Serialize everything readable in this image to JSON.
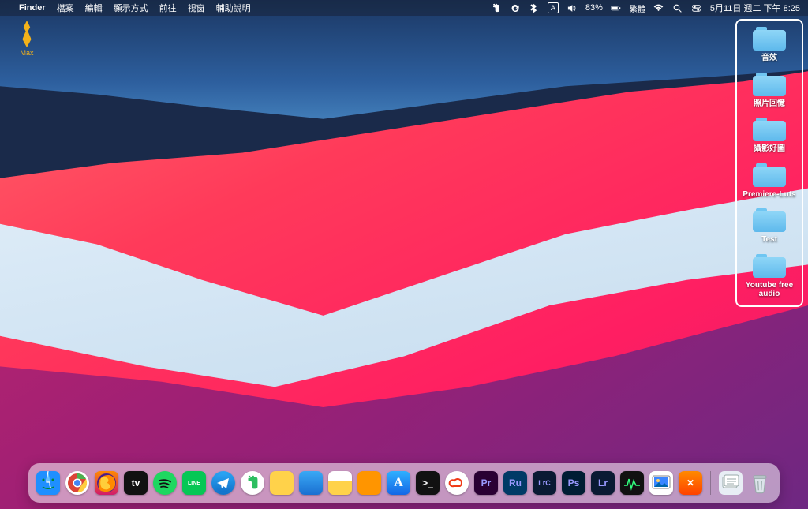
{
  "menubar": {
    "apple": "",
    "app_name": "Finder",
    "items": [
      "檔案",
      "編輯",
      "顯示方式",
      "前往",
      "視窗",
      "輔助說明"
    ],
    "status": {
      "battery": "83%",
      "input": "A",
      "lang": "繁體",
      "date": "5月11日 週二 下午 8:25"
    }
  },
  "desktop_icon": {
    "label": "Max"
  },
  "folders": [
    {
      "label": "音效"
    },
    {
      "label": "照片回憶"
    },
    {
      "label": "攝影好圖"
    },
    {
      "label": "Premiere-Luts"
    },
    {
      "label": "Test"
    },
    {
      "label": "Youtube free audio"
    }
  ],
  "dock": [
    {
      "name": "finder",
      "bg": "linear-gradient(#35a3f5,#1273e6)",
      "txt": ""
    },
    {
      "name": "chrome",
      "bg": "#fff",
      "txt": ""
    },
    {
      "name": "firefox",
      "bg": "linear-gradient(#ff8a00,#d11a6b)",
      "txt": ""
    },
    {
      "name": "apple-tv",
      "bg": "#111",
      "txt": "tv"
    },
    {
      "name": "spotify",
      "bg": "#1ed760",
      "txt": ""
    },
    {
      "name": "line",
      "bg": "#06c755",
      "txt": "LINE"
    },
    {
      "name": "telegram",
      "bg": "linear-gradient(#2aa4f4,#1271c9)",
      "txt": ""
    },
    {
      "name": "evernote",
      "bg": "#fff",
      "txt": ""
    },
    {
      "name": "stickies",
      "bg": "#ffd24a",
      "txt": ""
    },
    {
      "name": "timer",
      "bg": "linear-gradient(#3aa9f5,#1a6fd1)",
      "txt": ""
    },
    {
      "name": "notes",
      "bg": "linear-gradient(#fff 40%,#ffd24a 40%)",
      "txt": ""
    },
    {
      "name": "pages",
      "bg": "#ff9500",
      "txt": ""
    },
    {
      "name": "app-store",
      "bg": "linear-gradient(#2fb0ff,#1467e6)",
      "txt": "A"
    },
    {
      "name": "terminal",
      "bg": "#111",
      "txt": ">_"
    },
    {
      "name": "creative-cloud",
      "bg": "#fff",
      "txt": ""
    },
    {
      "name": "premiere",
      "bg": "#2a0033",
      "txt": "Pr"
    },
    {
      "name": "rush",
      "bg": "#003a66",
      "txt": "Ru"
    },
    {
      "name": "lr-classic",
      "bg": "#0a1a33",
      "txt": "LrC"
    },
    {
      "name": "photoshop",
      "bg": "#001d33",
      "txt": "Ps"
    },
    {
      "name": "lightroom",
      "bg": "#0a1a33",
      "txt": "Lr"
    },
    {
      "name": "activity",
      "bg": "#111",
      "txt": ""
    },
    {
      "name": "preview",
      "bg": "#fff",
      "txt": ""
    },
    {
      "name": "cleanmymac",
      "bg": "linear-gradient(#ff8a00,#ff4200)",
      "txt": "✕"
    }
  ],
  "dock_right": [
    {
      "name": "doc-stack",
      "bg": "#e8eef5"
    },
    {
      "name": "trash",
      "bg": "transparent"
    }
  ],
  "adobe_text": "#9999ff"
}
